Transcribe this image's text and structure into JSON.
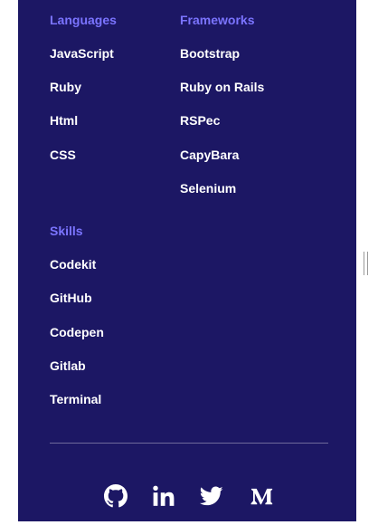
{
  "languages": {
    "heading": "Languages",
    "items": [
      "JavaScript",
      "Ruby",
      "Html",
      "CSS"
    ]
  },
  "frameworks": {
    "heading": "Frameworks",
    "items": [
      "Bootstrap",
      "Ruby on Rails",
      "RSPec",
      "CapyBara",
      "Selenium"
    ]
  },
  "skills": {
    "heading": "Skills",
    "items": [
      "Codekit",
      "GitHub",
      "Codepen",
      "Gitlab",
      "Terminal"
    ]
  },
  "social": [
    "github-icon",
    "linkedin-icon",
    "twitter-icon",
    "medium-icon"
  ],
  "colors": {
    "panel": "#1c1764",
    "heading": "#7b74ff",
    "text": "#ffffff"
  }
}
